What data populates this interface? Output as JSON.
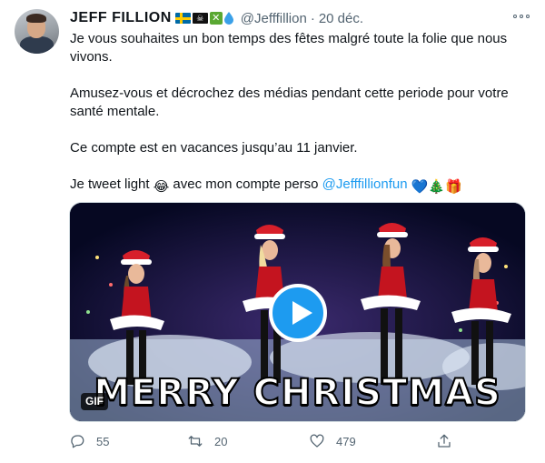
{
  "tweet": {
    "display_name": "JEFF FILLION",
    "handle": "@Jefffillion",
    "separator": "·",
    "date": "20 déc.",
    "paragraphs": [
      "Je vous souhaites un bon temps des fêtes malgré toute la folie que nous vivons.",
      "Amusez-vous et décrochez des médias pendant cette periode pour votre santé mentale.",
      "Ce compte est en vacances jusqu’au 11 janvier."
    ],
    "last_paragraph": {
      "text_before": "Je tweet light ",
      "emoji_laugh": "😂",
      "text_after": " avec mon compte perso ",
      "mention": "@Jefffillionfun",
      "emoji_trailing": "💙🎄🎁"
    },
    "name_emojis": [
      "swedish-flag",
      "pirate-flag",
      "x-mark",
      "droplet"
    ]
  },
  "media": {
    "badge": "GIF",
    "caption": "MERRY CHRISTMAS"
  },
  "actions": {
    "replies": "55",
    "retweets": "20",
    "likes": "479"
  },
  "colors": {
    "accent": "#1d9bf0",
    "secondary_text": "#536471",
    "heart": "#2f8ee8"
  }
}
